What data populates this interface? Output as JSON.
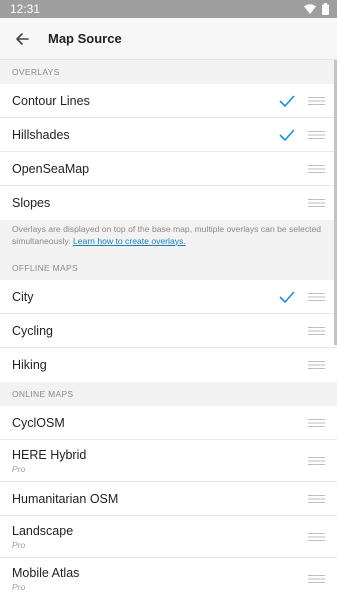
{
  "status": {
    "time": "12:31"
  },
  "header": {
    "title": "Map Source"
  },
  "sections": {
    "overlays": {
      "title": "OVERLAYS",
      "items": [
        {
          "label": "Contour Lines",
          "checked": true
        },
        {
          "label": "Hillshades",
          "checked": true
        },
        {
          "label": "OpenSeaMap",
          "checked": false
        },
        {
          "label": "Slopes",
          "checked": false
        }
      ],
      "note": "Overlays are displayed on top of the base map, multiple overlays can be selected simultaneously.",
      "link": "Learn how to create overlays."
    },
    "offline": {
      "title": "OFFLINE MAPS",
      "items": [
        {
          "label": "City",
          "checked": true
        },
        {
          "label": "Cycling",
          "checked": false
        },
        {
          "label": "Hiking",
          "checked": false
        }
      ]
    },
    "online": {
      "title": "ONLINE MAPS",
      "items": [
        {
          "label": "CyclOSM",
          "sub": ""
        },
        {
          "label": "HERE Hybrid",
          "sub": "Pro"
        },
        {
          "label": "Humanitarian OSM",
          "sub": ""
        },
        {
          "label": "Landscape",
          "sub": "Pro"
        },
        {
          "label": "Mobile Atlas",
          "sub": "Pro"
        }
      ]
    }
  },
  "colors": {
    "accent": "#1b8fd2",
    "link": "#1b7fb8"
  }
}
